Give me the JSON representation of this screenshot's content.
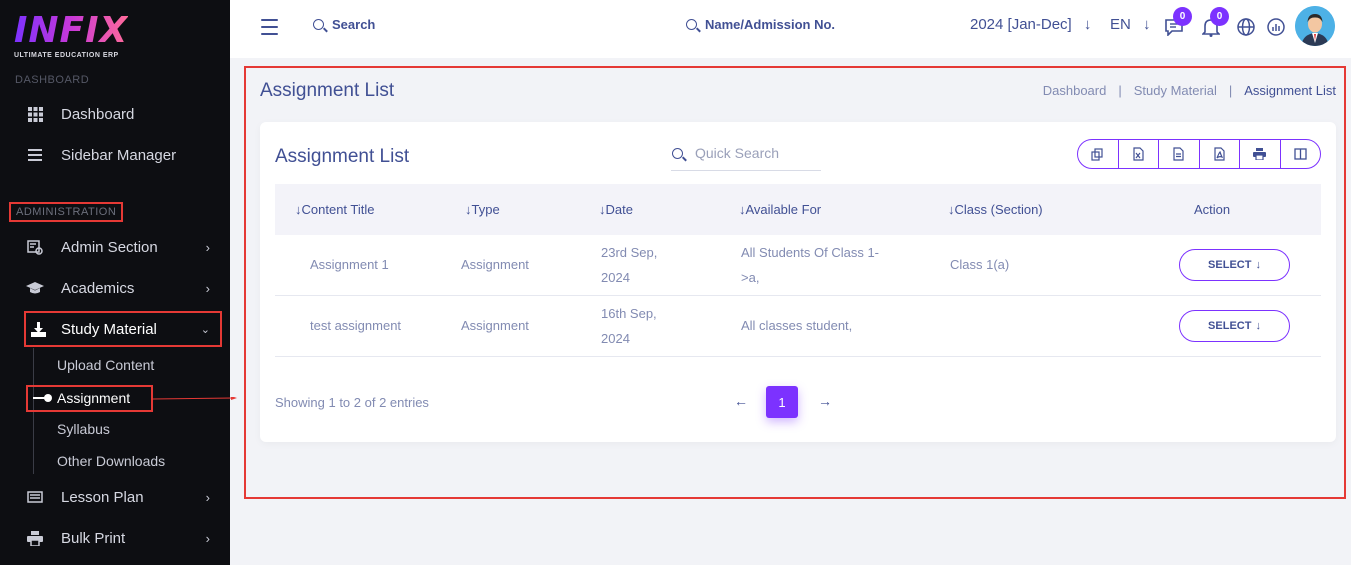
{
  "logo": {
    "word": "INFIX",
    "subtitle": "ULTIMATE EDUCATION ERP"
  },
  "sidebar": {
    "sections": {
      "dashboard": "DASHBOARD",
      "administration": "ADMINISTRATION"
    },
    "items": [
      {
        "label": "Dashboard",
        "icon": "grid-icon"
      },
      {
        "label": "Sidebar Manager",
        "icon": "list-icon"
      },
      {
        "label": "Admin Section",
        "icon": "admin-icon"
      },
      {
        "label": "Academics",
        "icon": "graduation-cap-icon"
      },
      {
        "label": "Study Material",
        "icon": "download-icon"
      },
      {
        "label": "Lesson Plan",
        "icon": "keyboard-icon"
      },
      {
        "label": "Bulk Print",
        "icon": "print-icon"
      }
    ],
    "submenu": [
      "Upload Content",
      "Assignment",
      "Syllabus",
      "Other Downloads"
    ]
  },
  "topbar": {
    "search": "Search",
    "admission_search": "Name/Admission No.",
    "year": "2024 [Jan-Dec]",
    "lang": "EN",
    "messages_count": "0",
    "notifications_count": "0"
  },
  "page": {
    "title": "Assignment List",
    "breadcrumb": [
      "Dashboard",
      "Study Material",
      "Assignment List"
    ]
  },
  "card": {
    "title": "Assignment List",
    "search_placeholder": "Quick Search",
    "columns": [
      "Content Title",
      "Type",
      "Date",
      "Available For",
      "Class (Section)",
      "Action"
    ],
    "rows": [
      {
        "title": "Assignment 1",
        "type": "Assignment",
        "date_l1": "23rd Sep,",
        "date_l2": "2024",
        "avail_l1": "All Students Of Class 1-",
        "avail_l2": ">a,",
        "class": "Class 1(a)",
        "action": "SELECT"
      },
      {
        "title": "test assignment",
        "type": "Assignment",
        "date_l1": "16th Sep,",
        "date_l2": "2024",
        "avail_l1": "All classes student,",
        "avail_l2": "",
        "class": "",
        "action": "SELECT"
      }
    ],
    "showing": "Showing 1 to 2 of 2 entries",
    "page": "1"
  },
  "colors": {
    "accent": "#7c32ff",
    "text": "#415094",
    "muted": "#828bb2",
    "highlight": "#e53935"
  }
}
